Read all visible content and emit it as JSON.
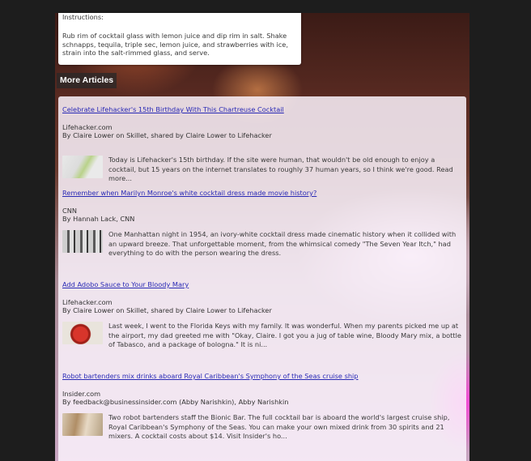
{
  "instructions": {
    "heading": "Instructions:",
    "body": "Rub rim of cocktail glass with lemon juice and dip rim in salt. Shake schnapps, tequila, triple sec, lemon juice, and strawberries with ice, strain into the salt-rimmed glass, and serve."
  },
  "more_articles": {
    "title": "More Articles",
    "items": [
      {
        "title": "Celebrate Lifehacker's 15th Birthday With This Chartreuse Cocktail",
        "source": "Lifehacker.com",
        "byline": "By Claire Lower on Skillet, shared by Claire Lower to Lifehacker",
        "summary": "Today is Lifehacker's 15th birthday. If the site were human, that wouldn't be old enough to enjoy a cocktail, but 15 years on the internet translates to roughly 37 human years, so I think we're good. Read more..."
      },
      {
        "title": "Remember when Marilyn Monroe's white cocktail dress made movie history?",
        "source": "CNN",
        "byline": "By Hannah Lack, CNN",
        "summary": "One Manhattan night in 1954, an ivory-white cocktail dress made cinematic history when it collided with an upward breeze. That unforgettable moment, from the whimsical comedy \"The Seven Year Itch,\" had everything to do with the person wearing the dress."
      },
      {
        "title": "Add Adobo Sauce to Your Bloody Mary",
        "source": "Lifehacker.com",
        "byline": "By Claire Lower on Skillet, shared by Claire Lower to Lifehacker",
        "summary": "Last week, I went to the Florida Keys with my family. It was wonderful. When my parents picked me up at the airport, my dad greeted me with \"Okay, Claire. I got you a jug of table wine, Bloody Mary mix, a bottle of Tabasco, and a package of bologna.\" It is ni..."
      },
      {
        "title": "Robot bartenders mix drinks aboard Royal Caribbean's Symphony of the Seas cruise ship",
        "source": "Insider.com",
        "byline": "By feedback@businessinsider.com (Abby Narishkin), Abby Narishkin",
        "summary": "Two robot bartenders staff the Bionic Bar. The full cocktail bar is aboard the world's largest cruise ship, Royal Caribbean's Symphony of the Seas. You can make your own mixed drink from 30 spirits and 21 mixers. A cocktail costs about $14. Visit Insider's ho..."
      }
    ]
  },
  "colors": {
    "link": "#2a2ab5",
    "accent_glow": "#ff3cdc"
  }
}
